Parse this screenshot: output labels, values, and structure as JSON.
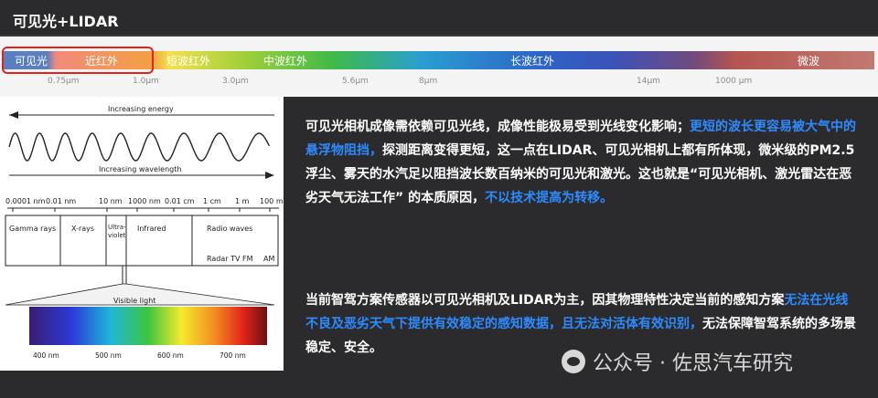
{
  "title": "可见光+LIDAR",
  "spectrum_bar": {
    "segments": [
      "可见光",
      "近红外",
      "短波红外",
      "中波红外",
      "长波红外",
      "微波"
    ],
    "ticks": [
      "0.75μm",
      "1.0μm",
      "3.0μm",
      "5.6μm",
      "8μm",
      "14μm",
      "1000 μm"
    ]
  },
  "figure": {
    "energy_label": "Increasing energy",
    "wavelength_label": "Increasing wavelength",
    "scale_ticks": [
      "0.0001 nm",
      "0.01 nm",
      "10 nm",
      "1000 nm",
      "0.01 cm",
      "1 cm",
      "1 m",
      "100 m"
    ],
    "bands": [
      "Gamma rays",
      "X-rays",
      "Ultra-\nviolet",
      "Infrared",
      "Radio waves"
    ],
    "radio_sub": "Radar  TV  FM",
    "am": "AM",
    "visible_label": "Visible light",
    "visible_ticks": [
      "400 nm",
      "500 nm",
      "600 nm",
      "700 nm"
    ]
  },
  "para1": [
    {
      "text": "可见光相机成像需依赖可见光线，成像性能极易受到光线变化影响；",
      "hl": false
    },
    {
      "text": "更短的波长更容易被大气中的悬浮物阻挡，",
      "hl": true
    },
    {
      "text": "探测距离变得更短，这一点在LIDAR、可见光相机上都有所体现，微米级的PM2.5浮尘、雾天的水汽足以阻挡波长数百纳米的可见光和激光。这也就是“可见光相机、激光雷达在恶劣天气无法工作” 的本质原因，",
      "hl": false
    },
    {
      "text": "不以技术提高为转移。",
      "hl": true
    }
  ],
  "para2": [
    {
      "text": "当前智驾方案传感器以可见光相机及LIDAR为主，因其物理特性决定当前的感知方案",
      "hl": false
    },
    {
      "text": "无法在光线不良及恶劣天气下提供有效稳定的感知数据，且无法对活体有效识别，",
      "hl": true
    },
    {
      "text": "无法保障智驾系统的多场景稳定、安全。",
      "hl": false
    }
  ],
  "watermark": "公众号 · 佐思汽车研究",
  "colors": {
    "highlight": "#2d8bff",
    "redbox": "#e2231a",
    "background": "#2b2b2d"
  }
}
